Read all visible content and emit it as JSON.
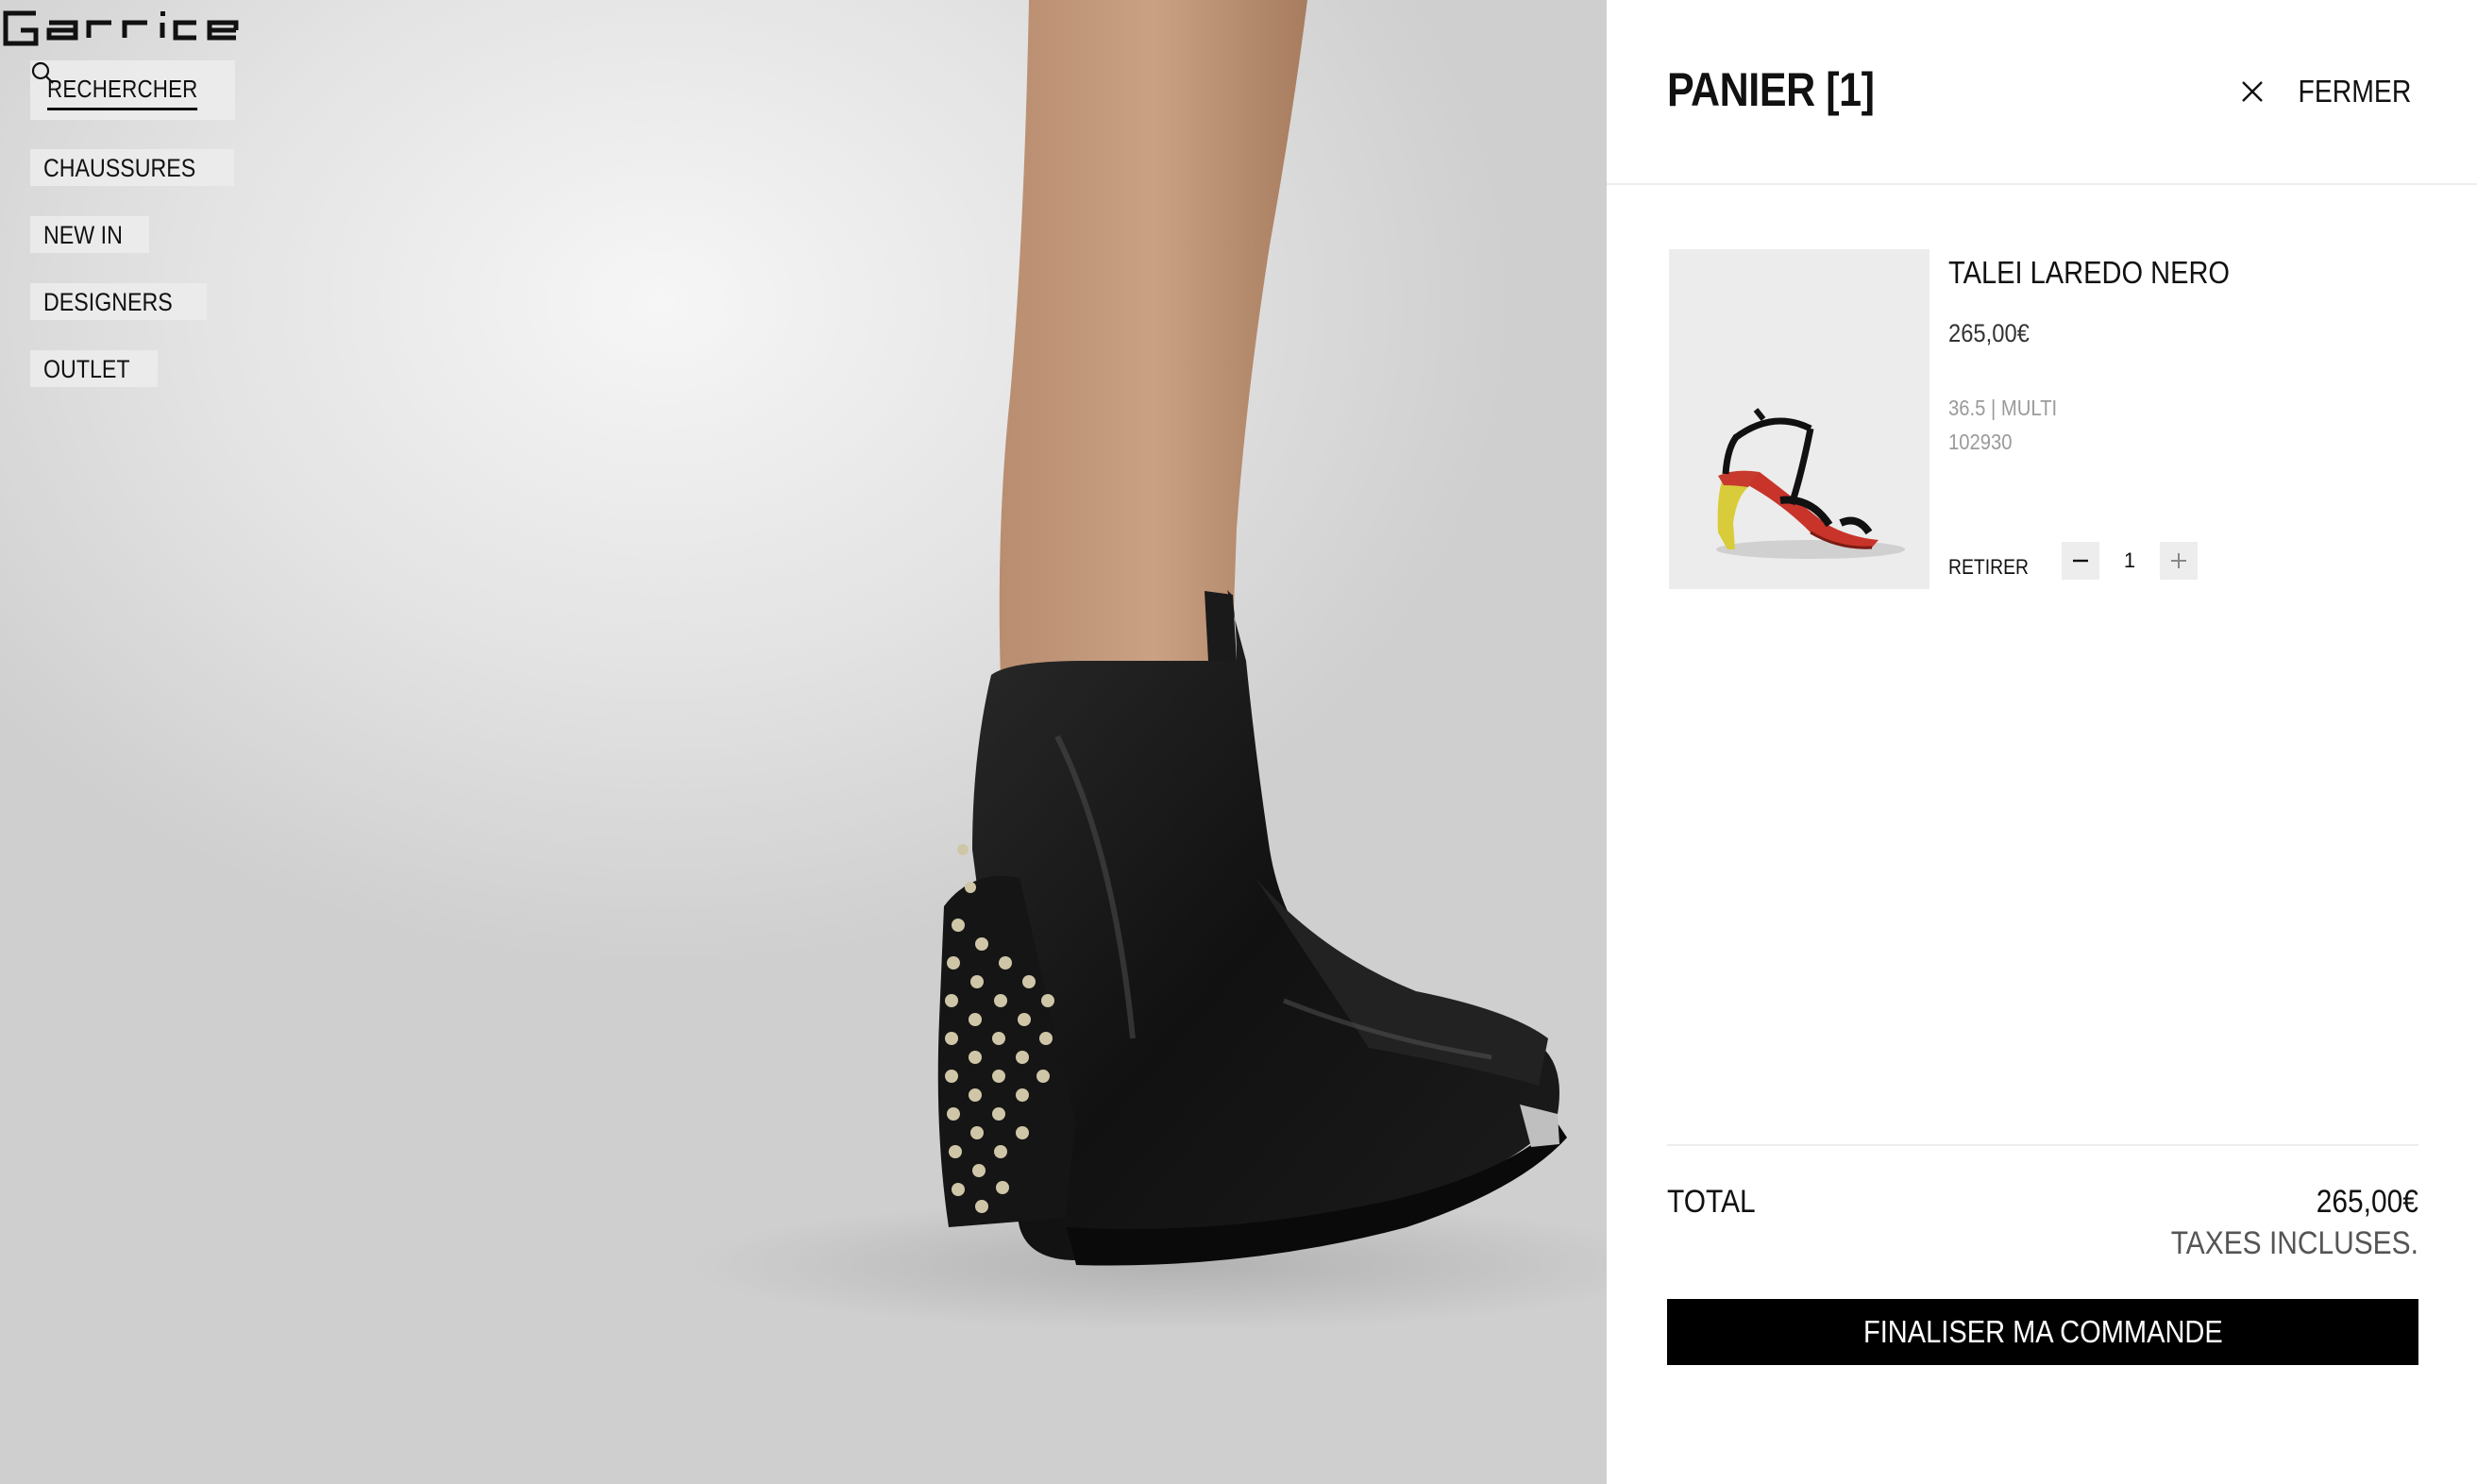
{
  "brand": {
    "logo_text": "Garrice"
  },
  "header": {
    "search_label": "RECHERCHER",
    "search_icon": "search-icon"
  },
  "nav": {
    "items": [
      {
        "label": "CHAUSSURES"
      },
      {
        "label": "NEW IN"
      },
      {
        "label": "DESIGNERS"
      },
      {
        "label": "OUTLET"
      }
    ]
  },
  "cart": {
    "title": "PANIER [1]",
    "close_label": "FERMER",
    "close_icon": "close-icon",
    "items": [
      {
        "name": "TALEI LAREDO NERO",
        "price": "265,00€",
        "variant": "36.5 | MULTI",
        "sku": "102930",
        "remove_label": "RETIRER",
        "quantity": "1",
        "image": "heeled-sandal-image"
      }
    ],
    "total_label": "TOTAL",
    "total_value": "265,00€",
    "tax_note": "TAXES INCLUSES.",
    "checkout_label": "FINALISER MA COMMANDE"
  },
  "hero": {
    "image": "studded-ankle-boot-photo"
  },
  "colors": {
    "drawer_bg": "#ffffff",
    "button_bg": "#000000",
    "muted_text": "#9a9a9a",
    "chip_bg": "#ececec"
  }
}
